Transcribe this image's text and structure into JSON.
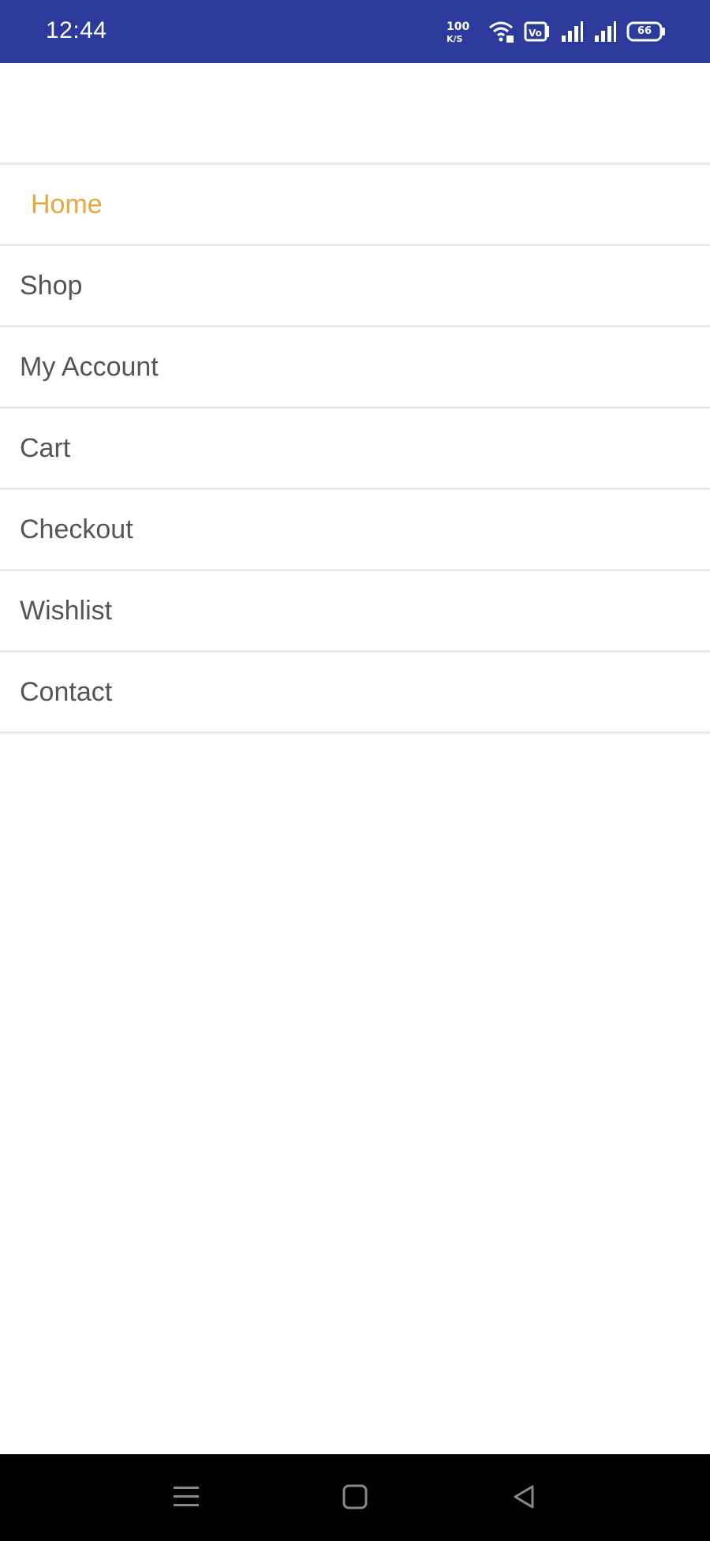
{
  "status_bar": {
    "time": "12:44",
    "battery": "66",
    "icons": [
      "speed-icon",
      "wifi-icon",
      "volte-icon",
      "signal-icon",
      "signal-icon",
      "battery-icon"
    ],
    "background": "#2c3a9c"
  },
  "menu": {
    "items": [
      {
        "label": "Home",
        "active": true
      },
      {
        "label": "Shop"
      },
      {
        "label": "My Account"
      },
      {
        "label": "Cart"
      },
      {
        "label": "Checkout"
      },
      {
        "label": "Wishlist"
      },
      {
        "label": "Contact"
      }
    ],
    "active_color": "#e8a641",
    "text_color": "#555555"
  },
  "nav_bar": {
    "buttons": [
      "menu-icon",
      "home-icon",
      "back-icon"
    ]
  }
}
